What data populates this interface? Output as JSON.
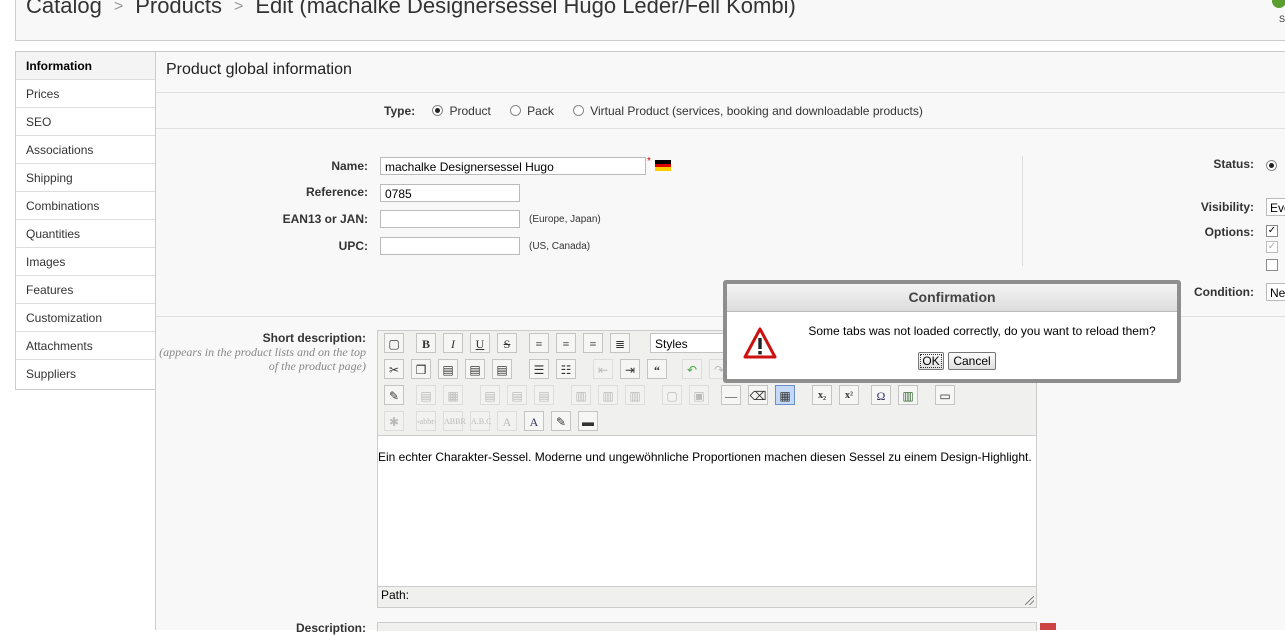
{
  "header": {
    "breadcrumb": [
      "Catalog",
      "Products",
      "Edit (machalke Designersessel Hugo Leder/Fell Kombi)"
    ],
    "separator": ">",
    "corner_letter": "S"
  },
  "sidebar": {
    "items": [
      {
        "label": "Information",
        "active": true
      },
      {
        "label": "Prices"
      },
      {
        "label": "SEO"
      },
      {
        "label": "Associations"
      },
      {
        "label": "Shipping"
      },
      {
        "label": "Combinations"
      },
      {
        "label": "Quantities"
      },
      {
        "label": "Images"
      },
      {
        "label": "Features"
      },
      {
        "label": "Customization"
      },
      {
        "label": "Attachments"
      },
      {
        "label": "Suppliers"
      }
    ]
  },
  "main": {
    "title": "Product global information",
    "type": {
      "label": "Type:",
      "options": [
        "Product",
        "Pack",
        "Virtual Product (services, booking and downloadable products)"
      ],
      "selected": "Product"
    },
    "fields": {
      "name": {
        "label": "Name:",
        "value": "machalke Designersessel Hugo",
        "required_mark": "*"
      },
      "reference": {
        "label": "Reference:",
        "value": "0785"
      },
      "ean13": {
        "label": "EAN13 or JAN:",
        "value": "",
        "hint": "(Europe, Japan)"
      },
      "upc": {
        "label": "UPC:",
        "value": "",
        "hint": "(US, Canada)"
      }
    },
    "right": {
      "status_label": "Status:",
      "visibility_label": "Visibility:",
      "visibility_value": "Eve",
      "options_label": "Options:",
      "condition_label": "Condition:",
      "condition_value": "Ne"
    },
    "short_description": {
      "label": "Short description:",
      "hint": "(appears in the product lists and on the top of the product page)",
      "styles_label": "Styles",
      "text": "Ein echter Charakter-Sessel. Moderne und ungewöhnliche Proportionen machen diesen Sessel zu einem Design-Highlight.",
      "path_label": "Path:"
    },
    "description": {
      "label": "Description:"
    }
  },
  "modal": {
    "title": "Confirmation",
    "message": "Some tabs was not loaded correctly, do you want to reload them?",
    "ok_label": "OK",
    "cancel_label": "Cancel"
  },
  "colors": {
    "flag_de": [
      "#000000",
      "#dd0000",
      "#ffce00"
    ],
    "warning_red": "#cc1111"
  }
}
